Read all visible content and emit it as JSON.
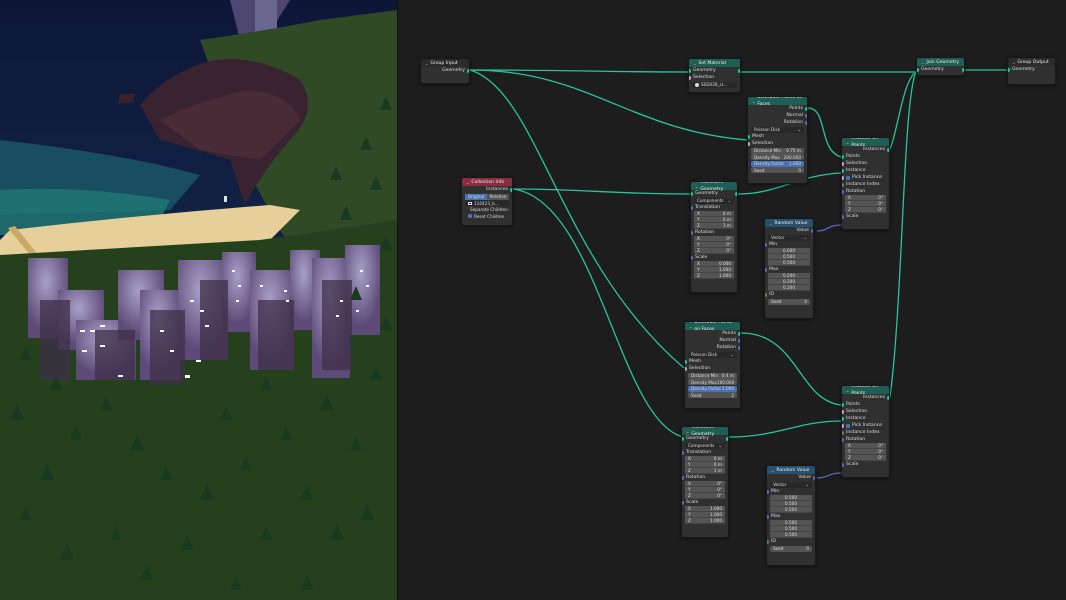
{
  "nodes": {
    "group_input": {
      "title": "Group Input",
      "geometry": "Geometry"
    },
    "group_output": {
      "title": "Group Output",
      "geometry": "Geometry"
    },
    "join_geometry": {
      "title": "Join Geometry",
      "geometry": "Geometry"
    },
    "set_material": {
      "title": "Set Material",
      "geometry": "Geometry",
      "selection": "Selection",
      "material": "SSD428_cl..."
    },
    "collection_info": {
      "title": "Collection Info",
      "instances": "Instances",
      "seg_original": "Original",
      "seg_relative": "Relative",
      "collection": "110423_b...",
      "separate_children": "Separate Children",
      "reset_children": "Reset Children"
    },
    "dp1": {
      "title": "Distribute Points on Faces",
      "points": "Points",
      "normal": "Normal",
      "rotation": "Rotation",
      "mode": "Poisson Disk",
      "mesh": "Mesh",
      "selection": "Selection",
      "dmin_label": "Distance Min",
      "dmin": "0.75 m",
      "dmax_label": "Density Max",
      "dmax": "200.000",
      "dfac_label": "Density Factor",
      "dfac": "1.000",
      "seed_label": "Seed",
      "seed": "0"
    },
    "dp2": {
      "title": "Distribute Points on Faces",
      "points": "Points",
      "normal": "Normal",
      "rotation": "Rotation",
      "mode": "Poisson Disk",
      "mesh": "Mesh",
      "selection": "Selection",
      "dmin_label": "Distance Min",
      "dmin": "0.4 m",
      "dmax_label": "Density Max",
      "dmax": "100.000",
      "dfac_label": "Density Factor",
      "dfac": "1.000",
      "seed_label": "Seed",
      "seed": "2"
    },
    "iop1": {
      "title": "Instance on Points",
      "instances": "Instances",
      "points": "Points",
      "selection": "Selection",
      "instance": "Instance",
      "pick": "Pick Instance",
      "index": "Instance Index",
      "rotation": "Rotation",
      "x": "X",
      "y": "Y",
      "z": "Z",
      "xv": "0°",
      "yv": "0°",
      "zv": "0°",
      "scale": "Scale"
    },
    "iop2": {
      "title": "Instance on Points",
      "instances": "Instances",
      "points": "Points",
      "selection": "Selection",
      "instance": "Instance",
      "pick": "Pick Instance",
      "index": "Instance Index",
      "rotation": "Rotation",
      "x": "X",
      "y": "Y",
      "z": "Z",
      "xv": "0°",
      "yv": "0°",
      "zv": "0°",
      "scale": "Scale"
    },
    "tg1": {
      "title": "Transform Geometry",
      "geometry": "Geometry",
      "mode": "Components",
      "translation": "Translation",
      "t": [
        "0 m",
        "0 m",
        "1 m"
      ],
      "rotation": "Rotation",
      "r": [
        "0°",
        "0°",
        "0°"
      ],
      "scale": "Scale",
      "s": [
        "0.000",
        "1.000",
        "1.000"
      ],
      "axes": [
        "X",
        "Y",
        "Z"
      ]
    },
    "tg2": {
      "title": "Transform Geometry",
      "geometry": "Geometry",
      "mode": "Components",
      "translation": "Translation",
      "t": [
        "0 m",
        "0 m",
        "1 m"
      ],
      "rotation": "Rotation",
      "r": [
        "0°",
        "0°",
        "0°"
      ],
      "scale": "Scale",
      "s": [
        "1.000",
        "1.000",
        "1.000"
      ],
      "axes": [
        "X",
        "Y",
        "Z"
      ]
    },
    "rv1": {
      "title": "Random Value",
      "value": "Value",
      "type": "Vector",
      "min": "Min",
      "minv": [
        "0.000",
        "0.500",
        "0.500"
      ],
      "max": "Max",
      "maxv": [
        "0.200",
        "0.200",
        "0.200"
      ],
      "id": "ID",
      "seed_label": "Seed",
      "seed": "0"
    },
    "rv2": {
      "title": "Random Value",
      "value": "Value",
      "type": "Vector",
      "min": "Min",
      "minv": [
        "0.500",
        "0.500",
        "0.500"
      ],
      "max": "Max",
      "maxv": [
        "0.500",
        "0.500",
        "0.500"
      ],
      "id": "ID",
      "seed_label": "Seed",
      "seed": "0"
    }
  },
  "colors": {
    "geometry_socket": "#00d6a3",
    "vector_socket": "#6363c7",
    "float_socket": "#a1a1a1",
    "geometry_header": "#1e5e54",
    "utility_header": "#25506e",
    "collection_header": "#8a2d40",
    "wire": "#27c59a"
  }
}
